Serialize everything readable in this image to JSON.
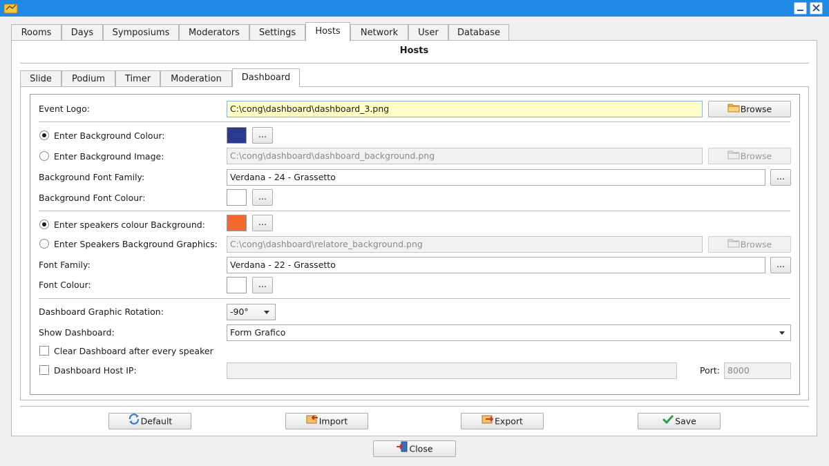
{
  "window": {
    "controls": {
      "minimize": "minimize-icon",
      "close": "close-icon"
    }
  },
  "top_tabs": [
    {
      "label": "Rooms"
    },
    {
      "label": "Days"
    },
    {
      "label": "Symposiums"
    },
    {
      "label": "Moderators"
    },
    {
      "label": "Settings"
    },
    {
      "label": "Hosts",
      "active": true
    },
    {
      "label": "Network"
    },
    {
      "label": "User"
    },
    {
      "label": "Database"
    }
  ],
  "page_title": "Hosts",
  "inner_tabs": [
    {
      "label": "Slide"
    },
    {
      "label": "Podium"
    },
    {
      "label": "Timer"
    },
    {
      "label": "Moderation"
    },
    {
      "label": "Dashboard",
      "active": true
    }
  ],
  "form": {
    "event_logo_label": "Event Logo:",
    "event_logo_value": "C:\\cong\\dashboard\\dashboard_3.png",
    "browse_label": "Browse",
    "ellipsis": "...",
    "bg_colour_label": "Enter Background Colour:",
    "bg_colour": "#2b3990",
    "bg_image_label": "Enter Background Image:",
    "bg_image_value": "C:\\cong\\dashboard\\dashboard_background.png",
    "bg_font_family_label": "Background Font Family:",
    "bg_font_family_value": "Verdana - 24 - Grassetto",
    "bg_font_colour_label": "Background Font Colour:",
    "bg_font_colour": "#ffffff",
    "speakers_colour_label": "Enter speakers colour Background:",
    "speakers_colour": "#f26a2e",
    "speakers_graphics_label": "Enter Speakers Background Graphics:",
    "speakers_graphics_value": "C:\\cong\\dashboard\\relatore_background.png",
    "font_family_label": "Font Family:",
    "font_family_value": "Verdana - 22 - Grassetto",
    "font_colour_label": "Font Colour:",
    "font_colour": "#ffffff",
    "rotation_label": "Dashboard Graphic Rotation:",
    "rotation_value": "-90°",
    "show_dashboard_label": "Show Dashboard:",
    "show_dashboard_value": "Form Grafico",
    "clear_dashboard_label": "Clear Dashboard after every speaker",
    "host_ip_label": "Dashboard Host IP:",
    "host_ip_value": "",
    "port_label": "Port:",
    "port_value": "8000"
  },
  "bottom_buttons": {
    "default_label": "Default",
    "import_label": "Import",
    "export_label": "Export",
    "save_label": "Save"
  },
  "close_label": "Close",
  "colors": {
    "titlebar": "#1f8ae6",
    "highlight_field": "#ffffc8"
  }
}
